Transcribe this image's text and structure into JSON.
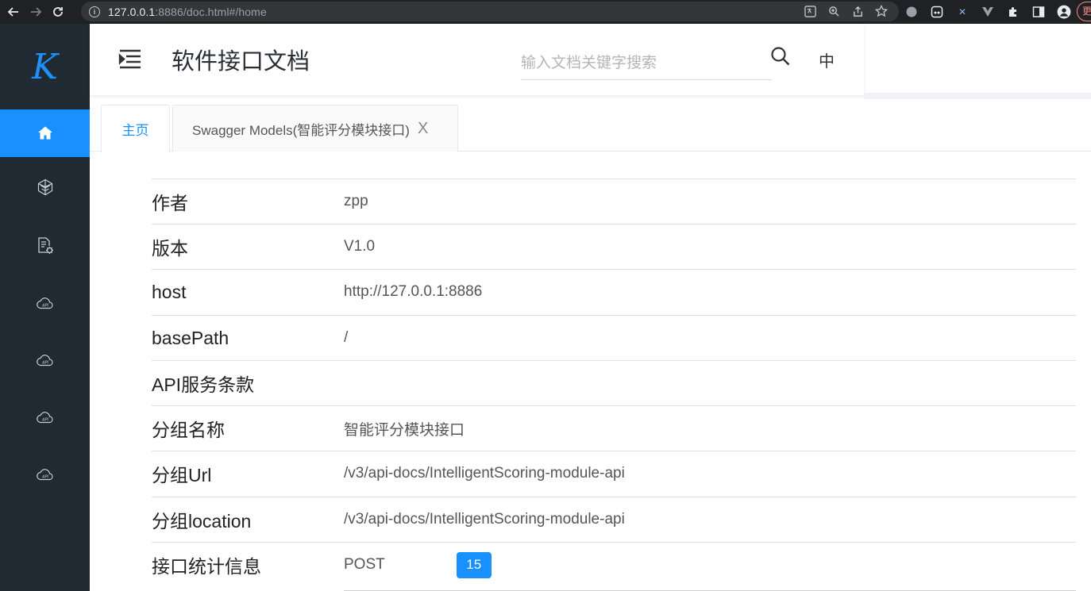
{
  "browser": {
    "url_host": "127.0.0.1",
    "url_rest": ":8886/doc.html#/home"
  },
  "sidebar": {
    "logo": "K",
    "items": [
      {
        "icon": "home-icon"
      },
      {
        "icon": "cube-icon"
      },
      {
        "icon": "doc-settings-icon"
      },
      {
        "icon": "api-cloud-icon"
      },
      {
        "icon": "api-cloud-icon"
      },
      {
        "icon": "api-cloud-icon"
      },
      {
        "icon": "api-cloud-icon"
      }
    ]
  },
  "header": {
    "title": "软件接口文档",
    "search_placeholder": "输入文档关键字搜索",
    "lang": "中"
  },
  "tabs": [
    {
      "label": "主页",
      "active": true
    },
    {
      "label": "Swagger Models(智能评分模块接口)",
      "close": "X",
      "active": false
    }
  ],
  "info": {
    "rows": [
      {
        "label": "作者",
        "value": "zpp"
      },
      {
        "label": "版本",
        "value": "V1.0"
      },
      {
        "label": "host",
        "value": "http://127.0.0.1:8886"
      },
      {
        "label": "basePath",
        "value": "/"
      },
      {
        "label": "API服务条款",
        "value": ""
      },
      {
        "label": "分组名称",
        "value": "智能评分模块接口"
      },
      {
        "label": "分组Url",
        "value": "/v3/api-docs/IntelligentScoring-module-api"
      },
      {
        "label": "分组location",
        "value": "/v3/api-docs/IntelligentScoring-module-api"
      },
      {
        "label": "接口统计信息",
        "value": "POST",
        "count": "15"
      }
    ]
  },
  "colors": {
    "sidebar_bg": "#1f2a33",
    "accent": "#1890ff"
  }
}
